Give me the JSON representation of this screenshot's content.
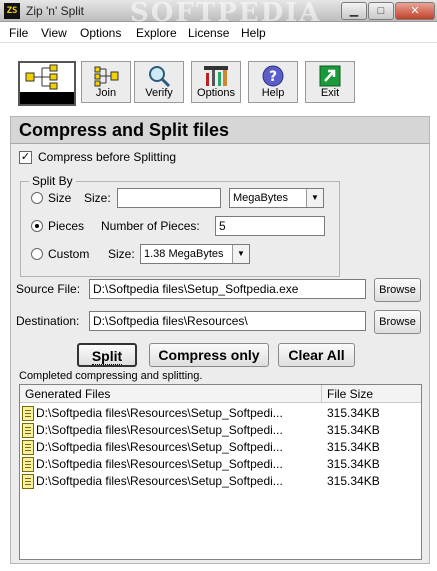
{
  "window": {
    "title": "Zip 'n' Split",
    "app_icon": "ZS",
    "watermark": "SOFTPEDIA"
  },
  "menu": [
    "File",
    "View",
    "Options",
    "Explore",
    "License",
    "Help"
  ],
  "toolbar": [
    {
      "label": "",
      "icon": "split-icon"
    },
    {
      "label": "Join",
      "icon": "join-icon"
    },
    {
      "label": "Verify",
      "icon": "magnifier-icon"
    },
    {
      "label": "Options",
      "icon": "tools-icon"
    },
    {
      "label": "Help",
      "icon": "help-icon"
    },
    {
      "label": "Exit",
      "icon": "exit-icon"
    }
  ],
  "section_title": "Compress and Split files",
  "compress_before_splitting": {
    "label": "Compress before Splitting",
    "checked": true
  },
  "split_by": {
    "group_label": "Split By",
    "size": {
      "radio_label": "Size",
      "field_label": "Size:",
      "value": "",
      "unit": "MegaBytes"
    },
    "pieces": {
      "radio_label": "Pieces",
      "field_label": "Number of Pieces:",
      "value": "5",
      "selected": true
    },
    "custom": {
      "radio_label": "Custom",
      "field_label": "Size:",
      "value": "1.38 MegaBytes"
    }
  },
  "source": {
    "label": "Source File:",
    "value": "D:\\Softpedia files\\Setup_Softpedia.exe",
    "browse": "Browse"
  },
  "destination": {
    "label": "Destination:",
    "value": "D:\\Softpedia files\\Resources\\",
    "browse": "Browse"
  },
  "actions": {
    "split": "Split",
    "compress_only": "Compress only",
    "clear_all": "Clear All"
  },
  "status": "Completed compressing and splitting.",
  "files_table": {
    "columns": [
      "Generated Files",
      "File Size"
    ],
    "rows": [
      {
        "name": "D:\\Softpedia files\\Resources\\Setup_Softpedi...",
        "size": "315.34KB"
      },
      {
        "name": "D:\\Softpedia files\\Resources\\Setup_Softpedi...",
        "size": "315.34KB"
      },
      {
        "name": "D:\\Softpedia files\\Resources\\Setup_Softpedi...",
        "size": "315.34KB"
      },
      {
        "name": "D:\\Softpedia files\\Resources\\Setup_Softpedi...",
        "size": "315.34KB"
      },
      {
        "name": "D:\\Softpedia files\\Resources\\Setup_Softpedi...",
        "size": "315.34KB"
      }
    ]
  }
}
